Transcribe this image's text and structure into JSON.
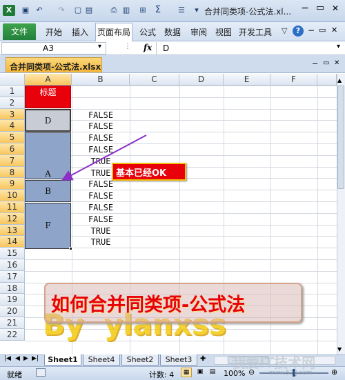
{
  "title_bar": {
    "title": "合并同类项-公式法.xl...",
    "min": "−",
    "restore": "▭",
    "close": "✕"
  },
  "ribbon": {
    "file": "文件",
    "tabs": [
      "开始",
      "插入",
      "页面布局",
      "公式",
      "数据",
      "审阅",
      "视图",
      "开发工具"
    ],
    "help": "?"
  },
  "formula_bar": {
    "name_box": "A3",
    "fx": "fx",
    "value": "D"
  },
  "workbook_tab": "合并同类项-公式法.xlsx",
  "columns": [
    "A",
    "B",
    "C",
    "D",
    "E",
    "F"
  ],
  "rows": [
    "1",
    "2",
    "3",
    "4",
    "5",
    "6",
    "7",
    "8",
    "9",
    "10",
    "11",
    "12",
    "13",
    "14",
    "15",
    "16",
    "17",
    "18",
    "19",
    "20",
    "21",
    "22"
  ],
  "cells": {
    "a1": "标题",
    "merged": [
      "D",
      "A",
      "B",
      "F"
    ],
    "col_b": [
      "FALSE",
      "FALSE",
      "FALSE",
      "FALSE",
      "TRUE",
      "TRUE",
      "FALSE",
      "FALSE",
      "FALSE",
      "FALSE",
      "TRUE",
      "TRUE"
    ]
  },
  "annotation": {
    "text": "基本已经OK"
  },
  "banner": {
    "text": "如何合并同类项-公式法"
  },
  "watermark": "By  ylanxss",
  "sheets": [
    "Sheet1",
    "Sheet4",
    "Sheet2",
    "Sheet3"
  ],
  "status": {
    "mode": "就绪",
    "count": "计数: 4",
    "zoom": "100%"
  },
  "site_watermark": "我爱IT技术网",
  "site_url": "www.52ij.com",
  "colors": {
    "title_red": "#e8000b",
    "merged_fill": "#8ea4c8",
    "selected_header": "#f8c65d",
    "file_green": "#2e8b3a"
  }
}
